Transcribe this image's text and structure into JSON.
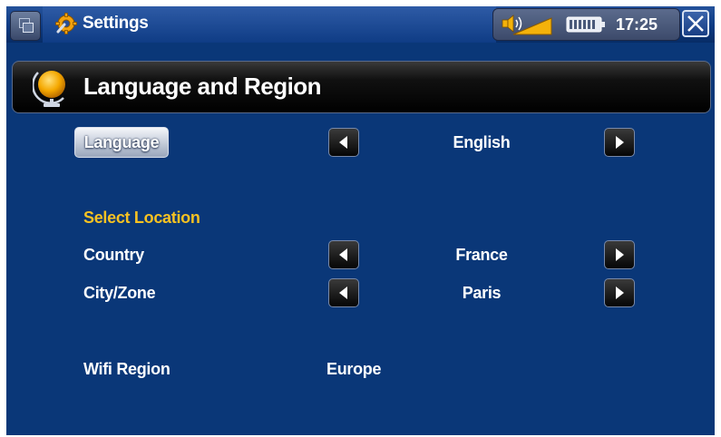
{
  "statusbar": {
    "app_title": "Settings",
    "clock": "17:25"
  },
  "header": {
    "title": "Language and Region"
  },
  "rows": {
    "language": {
      "label": "Language",
      "value": "English"
    },
    "section_location": "Select Location",
    "country": {
      "label": "Country",
      "value": "France"
    },
    "city_zone": {
      "label": "City/Zone",
      "value": "Paris"
    },
    "wifi_region": {
      "label": "Wifi Region",
      "value": "Europe"
    }
  },
  "icons": {
    "window": "window-switch-icon",
    "settings": "gear-icon",
    "volume": "volume-icon",
    "battery": "battery-icon",
    "close": "close-icon",
    "globe": "globe-icon",
    "prev": "arrow-left-icon",
    "next": "arrow-right-icon"
  },
  "colors": {
    "background": "#0a3778",
    "section_heading": "#f6c222",
    "text": "#ffffff"
  }
}
